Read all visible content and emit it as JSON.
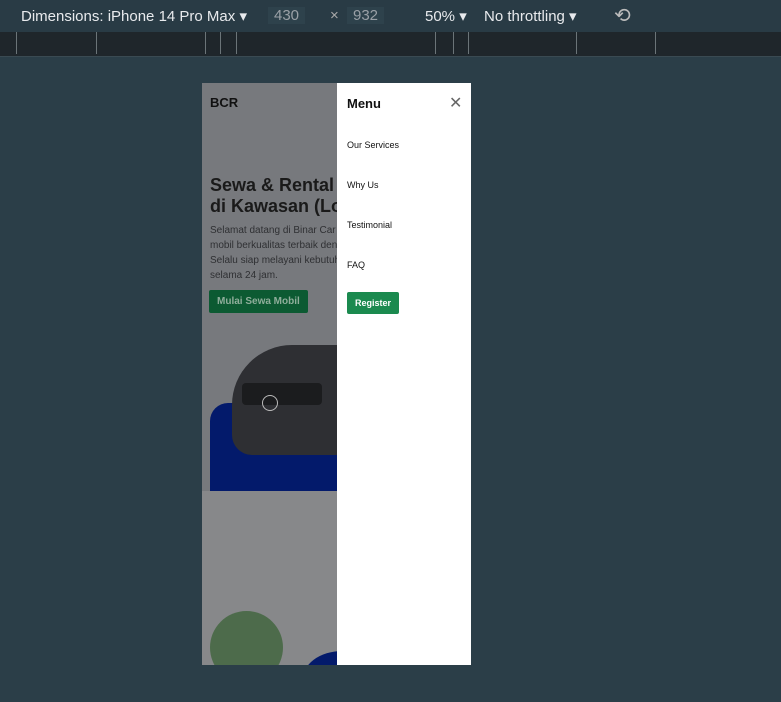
{
  "toolbar": {
    "device": "Dimensions: iPhone 14 Pro Max ▾",
    "width": "430",
    "times": "×",
    "height": "932",
    "zoom": "50% ▾",
    "throttle": "No throttling ▾"
  },
  "page": {
    "brand": "BCR",
    "headline_1": "Sewa & Rental Mobil Terbaik",
    "headline_2": "di Kawasan (Lokasimu)",
    "para": [
      "Selamat datang di Binar Car Rental. Kami menyediakan",
      "mobil berkualitas terbaik dengan harga terjangkau.",
      "Selalu siap melayani kebutuhanmu untuk sewa mobil",
      "selama 24 jam."
    ],
    "cta": "Mulai Sewa Mobil"
  },
  "menu": {
    "title": "Menu",
    "close": "✕",
    "items": [
      "Our Services",
      "Why Us",
      "Testimonial",
      "FAQ"
    ],
    "register": "Register"
  }
}
